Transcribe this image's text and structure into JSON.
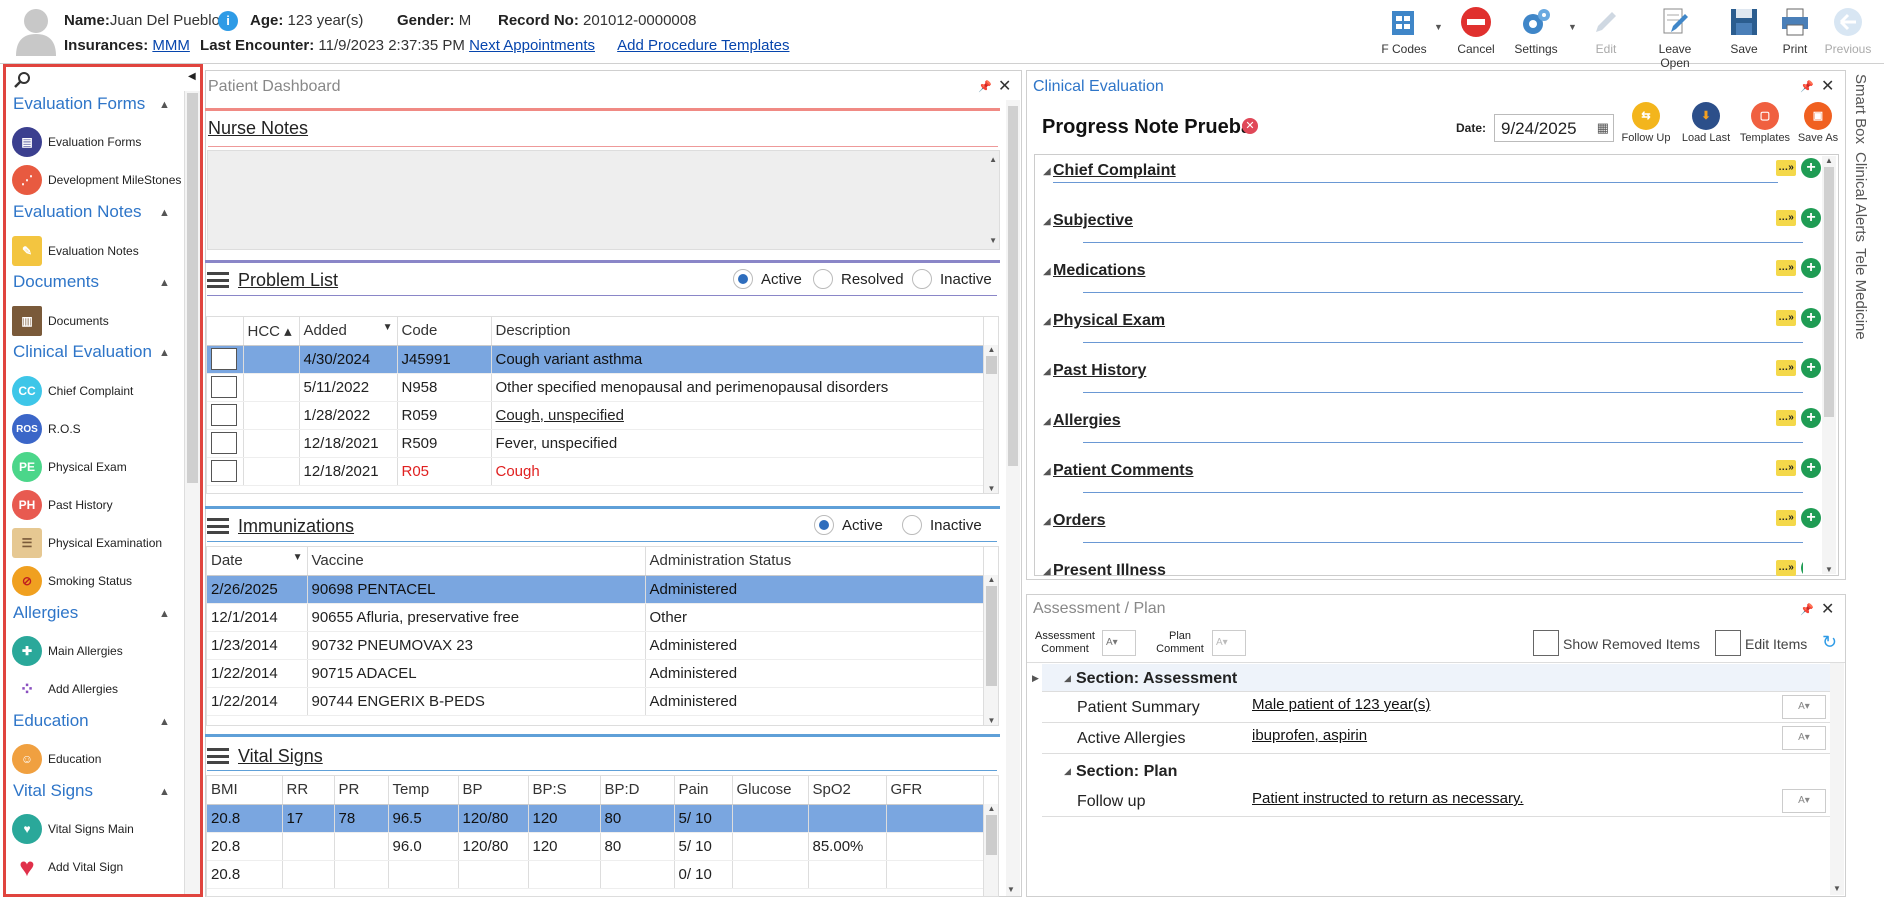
{
  "patient": {
    "name_label": "Name:",
    "name": "Juan Del Pueblo",
    "age_label": "Age:",
    "age": "123 year(s)",
    "gender_label": "Gender:",
    "gender": "M",
    "record_label": "Record No:",
    "record": "201012-0000008",
    "insurances_label": "Insurances:",
    "insurance": "MMM",
    "encounter_label": "Last Encounter:",
    "encounter": "11/9/2023 2:37:35 PM",
    "next_appointments": "Next Appointments",
    "add_procedure": "Add Procedure Templates"
  },
  "toolbar": {
    "fcodes": "F Codes",
    "cancel": "Cancel",
    "settings": "Settings",
    "edit": "Edit",
    "leave_open": "Leave Open",
    "save": "Save",
    "print": "Print",
    "previous": "Previous"
  },
  "sidebar": {
    "sections": [
      {
        "title": "Evaluation Forms",
        "items": [
          "Evaluation Forms",
          "Development MileStones"
        ]
      },
      {
        "title": "Evaluation Notes",
        "items": [
          "Evaluation Notes"
        ]
      },
      {
        "title": "Documents",
        "items": [
          "Documents"
        ]
      },
      {
        "title": "Clinical Evaluation",
        "items": [
          "Chief Complaint",
          "R.O.S",
          "Physical Exam",
          "Past History",
          "Physical Examination",
          "Smoking Status"
        ]
      },
      {
        "title": "Allergies",
        "items": [
          "Main Allergies",
          "Add Allergies"
        ]
      },
      {
        "title": "Education",
        "items": [
          "Education"
        ]
      },
      {
        "title": "Vital Signs",
        "items": [
          "Vital Signs Main",
          "Add Vital Sign"
        ]
      }
    ],
    "icon_abbr": {
      "cc": "CC",
      "ros": "ROS",
      "pe": "PE",
      "ph": "PH"
    }
  },
  "dashboard": {
    "title": "Patient Dashboard",
    "nurse_notes": "Nurse Notes",
    "problem_list": {
      "title": "Problem List",
      "filters": [
        "Active",
        "Resolved",
        "Inactive"
      ],
      "columns": [
        "HCC",
        "Added",
        "Code",
        "Description"
      ],
      "rows": [
        {
          "added": "4/30/2024",
          "code": "J45991",
          "desc": "Cough variant asthma"
        },
        {
          "added": "5/11/2022",
          "code": "N958",
          "desc": "Other specified menopausal and perimenopausal disorders"
        },
        {
          "added": "1/28/2022",
          "code": "R059",
          "desc": "Cough, unspecified"
        },
        {
          "added": "12/18/2021",
          "code": "R509",
          "desc": "Fever, unspecified"
        },
        {
          "added": "12/18/2021",
          "code": "R05",
          "desc": "Cough"
        }
      ]
    },
    "immunizations": {
      "title": "Immunizations",
      "filters": [
        "Active",
        "Inactive"
      ],
      "columns": [
        "Date",
        "Vaccine",
        "Administration Status"
      ],
      "rows": [
        {
          "date": "2/26/2025",
          "vaccine": "90698 PENTACEL",
          "status": "Administered"
        },
        {
          "date": "12/1/2014",
          "vaccine": "90655 Afluria, preservative free",
          "status": "Other"
        },
        {
          "date": "1/23/2014",
          "vaccine": "90732 PNEUMOVAX 23",
          "status": "Administered"
        },
        {
          "date": "1/22/2014",
          "vaccine": "90715 ADACEL",
          "status": "Administered"
        },
        {
          "date": "1/22/2014",
          "vaccine": "90744 ENGERIX B-PEDS",
          "status": "Administered"
        }
      ]
    },
    "vitals": {
      "title": "Vital Signs",
      "columns": [
        "BMI",
        "RR",
        "PR",
        "Temp",
        "BP",
        "BP:S",
        "BP:D",
        "Pain",
        "Glucose",
        "SpO2",
        "GFR"
      ],
      "rows": [
        [
          "20.8",
          "17",
          "78",
          "96.5",
          "120/80",
          "120",
          "80",
          "5/ 10",
          "",
          "",
          ""
        ],
        [
          "20.8",
          "",
          "",
          "96.0",
          "120/80",
          "120",
          "80",
          "5/ 10",
          "",
          "85.00%",
          ""
        ],
        [
          "20.8",
          "",
          "",
          "",
          "",
          "",
          "",
          "0/ 10",
          "",
          "",
          ""
        ]
      ]
    }
  },
  "clinical": {
    "title": "Clinical Evaluation",
    "note_title": "Progress Note Prueba",
    "date_label": "Date:",
    "date": "9/24/2025",
    "actions": [
      "Follow Up",
      "Load Last",
      "Templates",
      "Save As"
    ],
    "sections": [
      "Chief Complaint",
      "Subjective",
      "Medications",
      "Physical Exam",
      "Past History",
      "Allergies",
      "Patient Comments",
      "Orders",
      "Present Illness"
    ]
  },
  "assessment": {
    "title": "Assessment / Plan",
    "assessment_comment": "Assessment Comment",
    "plan_comment": "Plan Comment",
    "show_removed": "Show Removed Items",
    "edit_items": "Edit Items",
    "section_assessment": "Section: Assessment",
    "patient_summary_label": "Patient Summary",
    "patient_summary": "Male patient of 123 year(s)",
    "active_allergies_label": "Active Allergies",
    "active_allergies": "ibuprofen, aspirin",
    "section_plan": "Section: Plan",
    "follow_up_label": "Follow up",
    "follow_up": "Patient instructed to return as necessary."
  },
  "side_tabs": [
    "Smart Box",
    "Clinical Alerts",
    "Tele Medicine"
  ]
}
